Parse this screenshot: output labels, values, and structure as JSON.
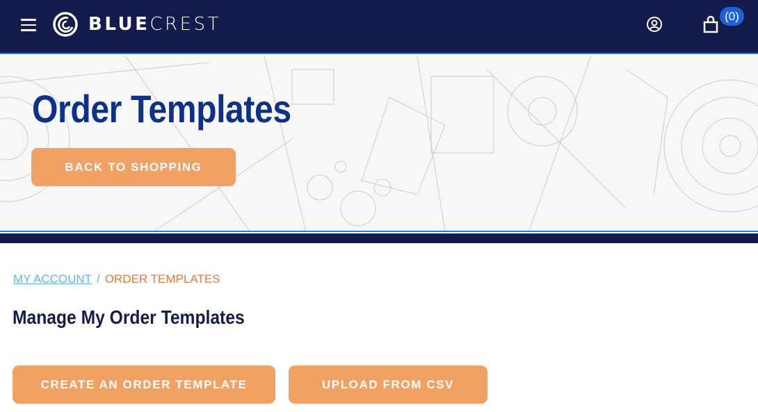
{
  "header": {
    "menu_icon": "hamburger-menu-icon",
    "brand_bold": "BLUE",
    "brand_light": "CREST",
    "account_icon": "user-circle-icon",
    "cart_icon": "shopping-bag-icon",
    "cart_count": "(0)"
  },
  "hero": {
    "title": "Order Templates",
    "back_button": "BACK TO SHOPPING"
  },
  "breadcrumb": {
    "items": [
      {
        "label": "MY ACCOUNT",
        "link": true
      },
      {
        "label": "ORDER TEMPLATES",
        "link": false
      }
    ],
    "separator": "/"
  },
  "main": {
    "section_title": "Manage My Order Templates",
    "create_button": "CREATE AN ORDER TEMPLATE",
    "upload_button": "UPLOAD FROM CSV"
  },
  "colors": {
    "navy": "#141c4d",
    "accent_blue": "#1d86d0",
    "title_blue": "#0d3189",
    "button_orange": "#f2a165",
    "breadcrumb_link": "#5bb8e6",
    "breadcrumb_current": "#e07a3f",
    "badge_blue": "#1e63d6"
  }
}
